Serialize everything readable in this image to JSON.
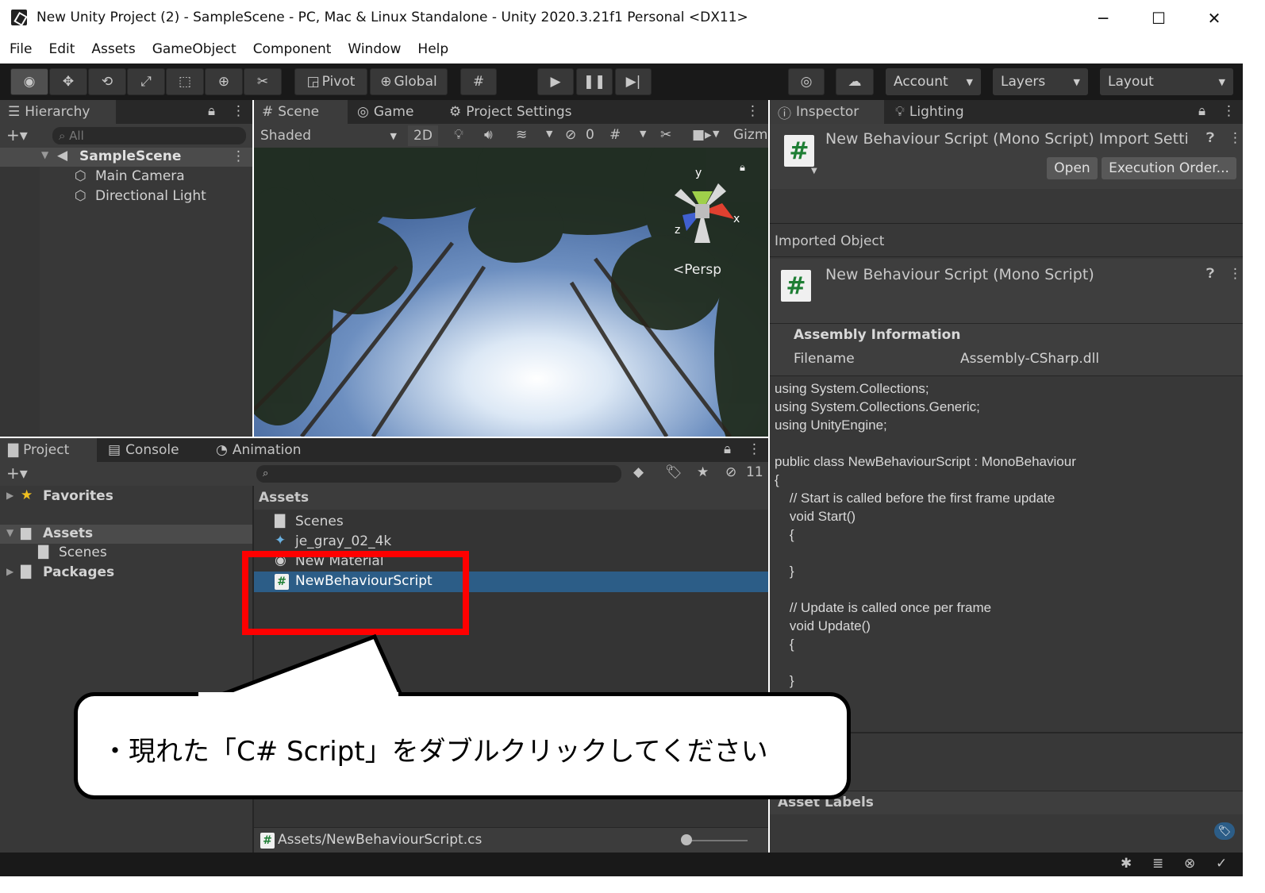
{
  "window": {
    "title": "New Unity Project (2) - SampleScene - PC, Mac & Linux Standalone - Unity 2020.3.21f1 Personal <DX11>",
    "minimize": "─",
    "maximize": "☐",
    "close": "✕"
  },
  "menu": [
    "File",
    "Edit",
    "Assets",
    "GameObject",
    "Component",
    "Window",
    "Help"
  ],
  "toolbar": {
    "pivot": "Pivot",
    "global": "Global",
    "account": "Account",
    "layers": "Layers",
    "layout": "Layout"
  },
  "hierarchy": {
    "tab": "Hierarchy",
    "search_placeholder": "All",
    "scene": "SampleScene",
    "items": [
      "Main Camera",
      "Directional Light"
    ]
  },
  "scene_view": {
    "tabs": [
      "Scene",
      "Game",
      "Project Settings"
    ],
    "shading": "Shaded",
    "mode_2d": "2D",
    "hidden_count": "0",
    "gizmos": "Gizm",
    "persp": "Persp",
    "axis_x": "x",
    "axis_y": "y",
    "axis_z": "z"
  },
  "inspector": {
    "tabs": [
      "Inspector",
      "Lighting"
    ],
    "header_title": "New Behaviour Script (Mono Script) Import Setti",
    "open_button": "Open",
    "execution_order_button": "Execution Order...",
    "imported_object_label": "Imported Object",
    "object_title": "New Behaviour Script (Mono Script)",
    "assembly_heading": "Assembly Information",
    "filename_label": "Filename",
    "filename_value": "Assembly-CSharp.dll",
    "code_lines": [
      "using System.Collections;",
      "using System.Collections.Generic;",
      "using UnityEngine;",
      "",
      "public class NewBehaviourScript : MonoBehaviour",
      "{",
      "    // Start is called before the first frame update",
      "    void Start()",
      "    {",
      "",
      "    }",
      "",
      "    // Update is called once per frame",
      "    void Update()",
      "    {",
      "",
      "    }"
    ],
    "asset_labels": "Asset Labels"
  },
  "project": {
    "tabs": [
      "Project",
      "Console",
      "Animation"
    ],
    "hidden_count": "11",
    "tree": {
      "favorites": "Favorites",
      "assets": "Assets",
      "scenes": "Scenes",
      "packages": "Packages"
    },
    "breadcrumb": "Assets",
    "items": [
      "Scenes",
      "je_gray_02_4k",
      "New Material",
      "NewBehaviourScript"
    ],
    "selected_path": "Assets/NewBehaviourScript.cs"
  },
  "callout": {
    "text": "・現れた「C# Script」をダブルクリックしてください"
  },
  "colors": {
    "highlight": "#ff0000",
    "selection": "#2c5d87",
    "editor_bg": "#383838"
  }
}
